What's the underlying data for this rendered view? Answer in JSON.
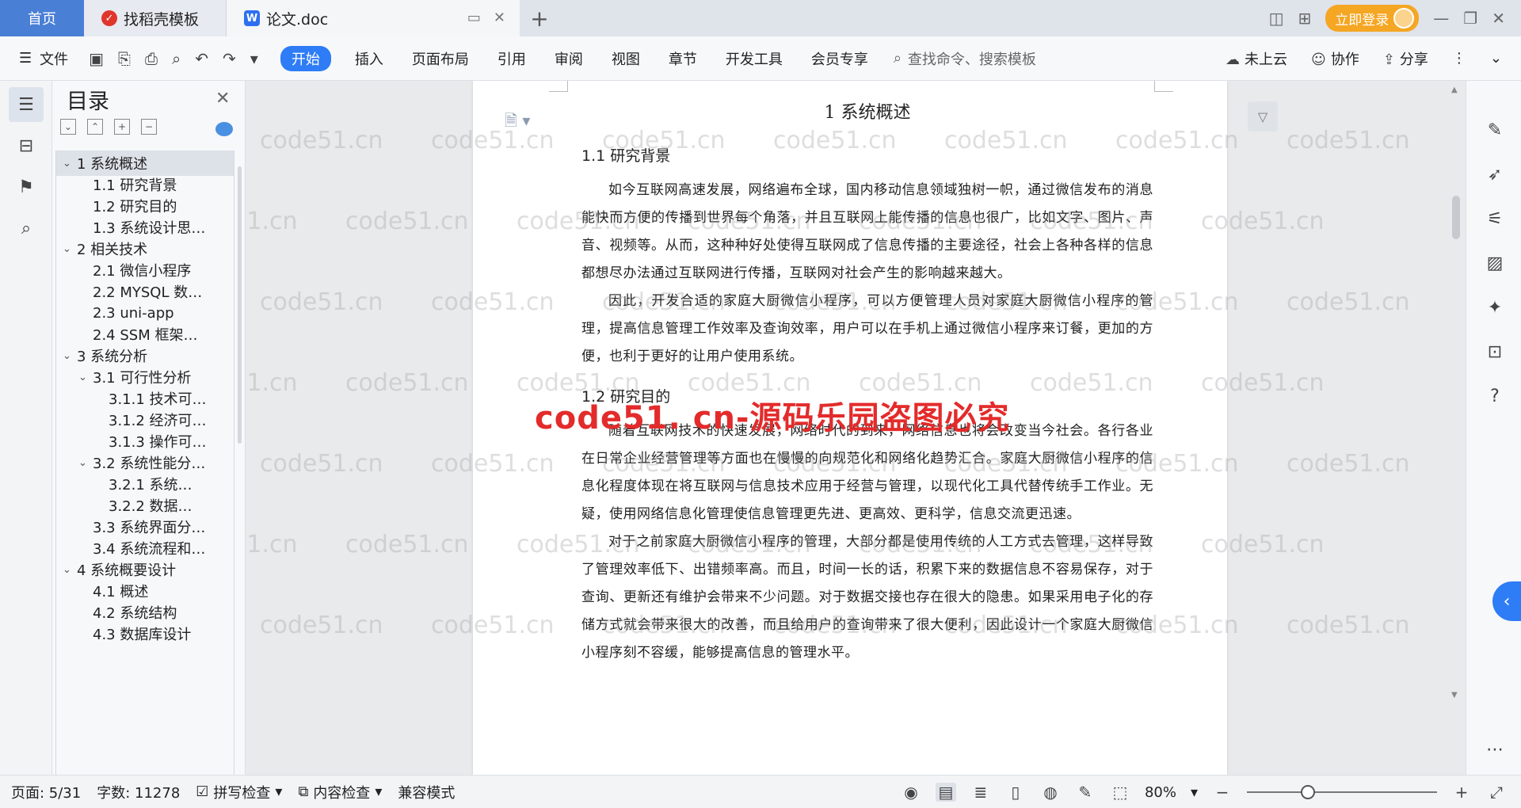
{
  "tabs": {
    "home": "首页",
    "template": "找稻壳模板",
    "doc": "论文.doc",
    "new_tab": "+"
  },
  "account": {
    "login": "立即登录"
  },
  "menu": {
    "file": "文件",
    "items": [
      "开始",
      "插入",
      "页面布局",
      "引用",
      "审阅",
      "视图",
      "章节",
      "开发工具",
      "会员专享"
    ],
    "search_placeholder": "查找命令、搜索模板",
    "cloud": "未上云",
    "collab": "协作",
    "share": "分享"
  },
  "toc": {
    "title": "目录",
    "items": [
      {
        "label": "1 系统概述",
        "level": 1,
        "expanded": true,
        "selected": true
      },
      {
        "label": "1.1  研究背景",
        "level": 2
      },
      {
        "label": "1.2 研究目的",
        "level": 2
      },
      {
        "label": "1.3 系统设计思…",
        "level": 2
      },
      {
        "label": "2 相关技术",
        "level": 1,
        "expanded": true
      },
      {
        "label": "2.1 微信小程序",
        "level": 2
      },
      {
        "label": "2.2 MYSQL 数…",
        "level": 2
      },
      {
        "label": "2.3 uni-app",
        "level": 2
      },
      {
        "label": "2.4 SSM 框架…",
        "level": 2
      },
      {
        "label": "3 系统分析",
        "level": 1,
        "expanded": true
      },
      {
        "label": "3.1 可行性分析",
        "level": 2,
        "expanded": true
      },
      {
        "label": "3.1.1 技术可…",
        "level": 3
      },
      {
        "label": "3.1.2 经济可…",
        "level": 3
      },
      {
        "label": "3.1.3 操作可…",
        "level": 3
      },
      {
        "label": "3.2 系统性能分…",
        "level": 2,
        "expanded": true
      },
      {
        "label": "3.2.1  系统…",
        "level": 3
      },
      {
        "label": "3.2.2  数据…",
        "level": 3
      },
      {
        "label": "3.3 系统界面分…",
        "level": 2
      },
      {
        "label": "3.4 系统流程和…",
        "level": 2
      },
      {
        "label": "4 系统概要设计",
        "level": 1,
        "expanded": true
      },
      {
        "label": "4.1 概述",
        "level": 2
      },
      {
        "label": "4.2 系统结构",
        "level": 2
      },
      {
        "label": "4.3 数据库设计",
        "level": 2
      }
    ]
  },
  "document": {
    "chapter_title": "1 系统概述",
    "section1_title": "1.1  研究背景",
    "section1_p1": "如今互联网高速发展，网络遍布全球，国内移动信息领域独树一帜，通过微信发布的消息能快而方便的传播到世界每个角落，并且互联网上能传播的信息也很广，比如文字、图片、声音、视频等。从而，这种种好处使得互联网成了信息传播的主要途径，社会上各种各样的信息都想尽办法通过互联网进行传播，互联网对社会产生的影响越来越大。",
    "section1_p2": "因此，开发合适的家庭大厨微信小程序，可以方便管理人员对家庭大厨微信小程序的管理，提高信息管理工作效率及查询效率，用户可以在手机上通过微信小程序来订餐，更加的方便，也利于更好的让用户使用系统。",
    "section2_title": "1.2 研究目的",
    "section2_p1": "随着互联网技术的快速发展，网络时代的到来，网络信息也将会改变当今社会。各行各业在日常企业经营管理等方面也在慢慢的向规范化和网络化趋势汇合。家庭大厨微信小程序的信息化程度体现在将互联网与信息技术应用于经营与管理，以现代化工具代替传统手工作业。无疑，使用网络信息化管理使信息管理更先进、更高效、更科学，信息交流更迅速。",
    "section2_p2": "对于之前家庭大厨微信小程序的管理，大部分都是使用传统的人工方式去管理，这样导致了管理效率低下、出错频率高。而且，时间一长的话，积累下来的数据信息不容易保存，对于查询、更新还有维护会带来不少问题。对于数据交接也存在很大的隐患。如果采用电子化的存储方式就会带来很大的改善，而且给用户的查询带来了很大便利，因此设计一个家庭大厨微信小程序刻不容缓，能够提高信息的管理水平。"
  },
  "watermark": {
    "red_text": "code51. cn-源码乐园盗图必究",
    "grey_text": "code51.cn"
  },
  "status": {
    "page": "页面: 5/31",
    "words": "字数: 11278",
    "spell": "拼写检查",
    "content_check": "内容检查",
    "compat": "兼容模式",
    "zoom": "80%",
    "zoom_level": 0.32
  }
}
